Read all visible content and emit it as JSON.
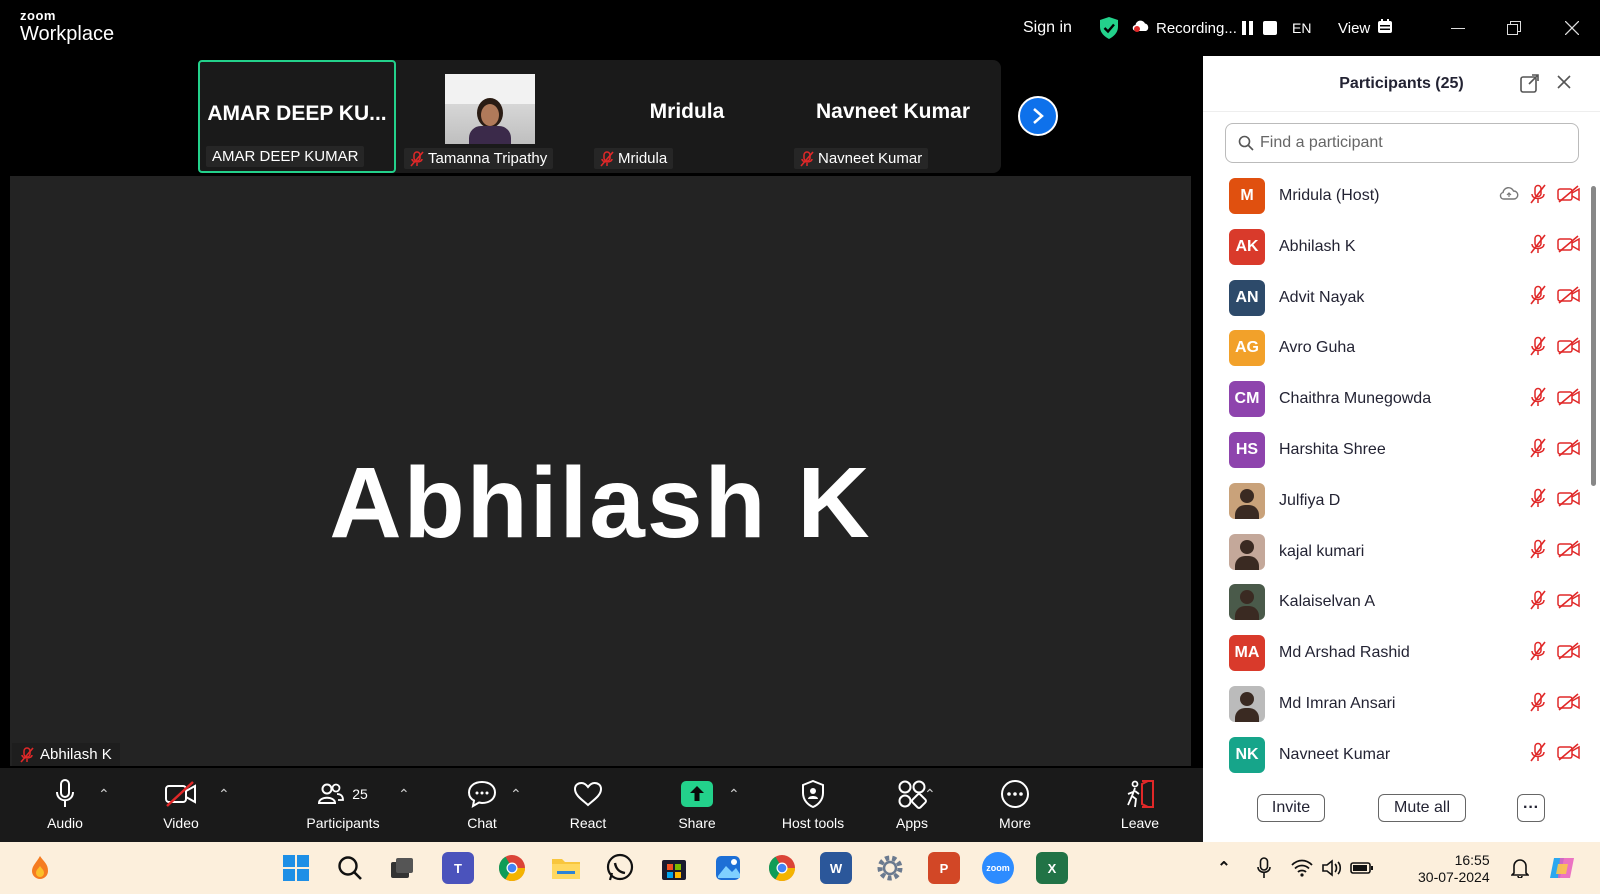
{
  "titlebar": {
    "brand_top": "zoom",
    "brand_bottom": "Workplace",
    "sign_in": "Sign in",
    "recording": "Recording...",
    "language": "EN",
    "view": "View"
  },
  "thumbnails": [
    {
      "big_name": "AMAR DEEP KU...",
      "tag": "AMAR DEEP KUMAR",
      "muted": false,
      "active": true
    },
    {
      "big_name": "",
      "tag": "Tamanna Tripathy",
      "muted": true,
      "active": false
    },
    {
      "big_name": "Mridula",
      "tag": "Mridula",
      "muted": true,
      "active": false
    },
    {
      "big_name": "Navneet Kumar",
      "tag": "Navneet Kumar",
      "muted": true,
      "active": false
    }
  ],
  "main": {
    "speaker": "Abhilash K",
    "name_tag": "Abhilash K"
  },
  "toolbar": {
    "audio": "Audio",
    "video": "Video",
    "participants": "Participants",
    "participants_count": "25",
    "chat": "Chat",
    "react": "React",
    "share": "Share",
    "host_tools": "Host tools",
    "apps": "Apps",
    "more": "More",
    "leave": "Leave"
  },
  "panel": {
    "title": "Participants (25)",
    "search_placeholder": "Find a participant",
    "invite": "Invite",
    "mute_all": "Mute all",
    "more": "···",
    "participants": [
      {
        "initials": "M",
        "name": "Mridula (Host)",
        "color": "#e0500f",
        "photo": false
      },
      {
        "initials": "AK",
        "name": "Abhilash K",
        "color": "#d93a2b",
        "photo": false
      },
      {
        "initials": "AN",
        "name": "Advit Nayak",
        "color": "#2d4a6a",
        "photo": false
      },
      {
        "initials": "AG",
        "name": "Avro Guha",
        "color": "#f2a12a",
        "photo": false
      },
      {
        "initials": "CM",
        "name": "Chaithra Munegowda",
        "color": "#8e44ad",
        "photo": false
      },
      {
        "initials": "HS",
        "name": "Harshita Shree",
        "color": "#8e44ad",
        "photo": false
      },
      {
        "initials": "",
        "name": "Julfiya D",
        "color": "#c9a27a",
        "photo": true
      },
      {
        "initials": "",
        "name": "kajal kumari",
        "color": "#c4a89a",
        "photo": true
      },
      {
        "initials": "",
        "name": "Kalaiselvan A",
        "color": "#4a5a4a",
        "photo": true
      },
      {
        "initials": "MA",
        "name": "Md Arshad Rashid",
        "color": "#d93a2b",
        "photo": false
      },
      {
        "initials": "",
        "name": "Md Imran Ansari",
        "color": "#bbbbbb",
        "photo": true
      },
      {
        "initials": "NK",
        "name": "Navneet Kumar",
        "color": "#16a58a",
        "photo": false
      }
    ]
  },
  "taskbar": {
    "time": "16:55",
    "date": "30-07-2024"
  },
  "colors": {
    "accent_green": "#23d18b",
    "zoom_blue": "#0e71eb",
    "muted_red": "#e02828",
    "share_green": "#23d18b"
  }
}
